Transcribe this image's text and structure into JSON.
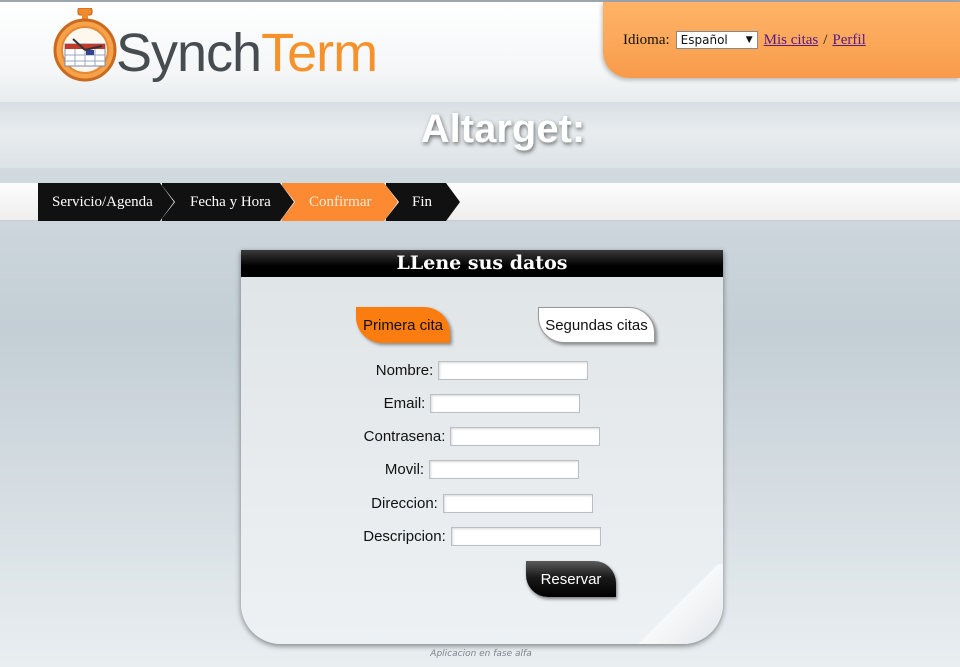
{
  "header": {
    "logo_text_part1": "Synch",
    "logo_text_part2": "Term",
    "language_label": "Idioma:",
    "language_selected": "Español",
    "link_appointments": "Mis citas",
    "separator": "/",
    "link_profile": "Perfil"
  },
  "page_title": "Altarget:",
  "steps": [
    {
      "label": "Servicio/Agenda",
      "active": false
    },
    {
      "label": "Fecha y Hora",
      "active": false
    },
    {
      "label": "Confirmar",
      "active": true
    },
    {
      "label": "Fin",
      "active": false
    }
  ],
  "form": {
    "title": "LLene sus datos",
    "tab_first": "Primera cita",
    "tab_second": "Segundas citas",
    "fields": [
      {
        "label": "Nombre:",
        "value": ""
      },
      {
        "label": "Email:",
        "value": ""
      },
      {
        "label": "Contrasena:",
        "value": ""
      },
      {
        "label": "Movil:",
        "value": ""
      },
      {
        "label": "Direccion:",
        "value": ""
      },
      {
        "label": "Descripcion:",
        "value": ""
      }
    ],
    "submit_label": "Reservar"
  },
  "footer_note": "Aplicacion en fase alfa",
  "colors": {
    "accent_orange": "#fb8a33",
    "logo_dark": "#474c51",
    "logo_orange": "#f6922b",
    "step_dark": "#111111"
  }
}
